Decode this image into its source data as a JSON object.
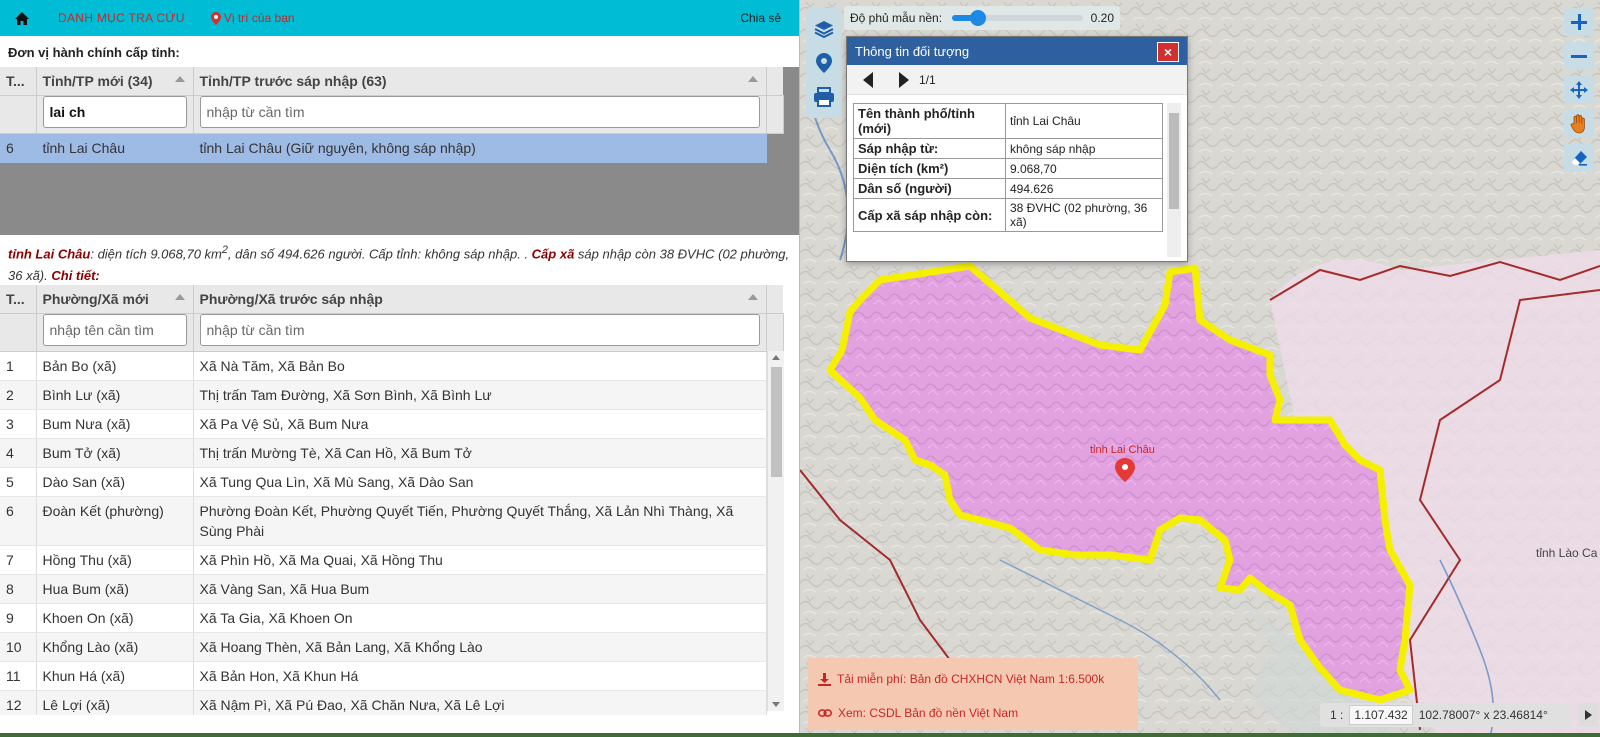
{
  "topbar": {
    "menu": "DANH MỤC TRA CỨU",
    "location": "Vị trí của bạn",
    "share": "Chia sẻ"
  },
  "province_section": {
    "title": "Đơn vị hành chính cấp tỉnh:",
    "columns": [
      "T...",
      "Tỉnh/TP mới (34)",
      "Tỉnh/TP trước sáp nhập (63)"
    ],
    "filter_new_value": "lai ch",
    "filter_old_placeholder": "nhập từ cần tìm",
    "rows": [
      {
        "stt": "6",
        "new": "tỉnh Lai Châu",
        "old": "tỉnh Lai Châu (Giữ nguyên, không sáp nhập)"
      }
    ]
  },
  "summary": {
    "name": "tỉnh Lai Châu",
    "text1": ": diện tích 9.068,70 km",
    "sup": "2",
    "text2": ", dân số 494.626 người. Cấp tỉnh: không sáp nhập. . ",
    "cx_label": "Cấp xã",
    "text3": " sáp nhập còn 38 ĐVHC (02 phường, 36 xã). ",
    "detail": "Chi tiết",
    "colon": ":"
  },
  "ward_section": {
    "columns": [
      "T...",
      "Phường/Xã mới",
      "Phường/Xã trước sáp nhập"
    ],
    "filter_new_placeholder": "nhập tên cần tìm",
    "filter_old_placeholder": "nhập từ cần tìm",
    "rows": [
      {
        "stt": "1",
        "new": "Bản Bo (xã)",
        "old": "Xã Nà Tăm, Xã Bản Bo"
      },
      {
        "stt": "2",
        "new": "Bình Lư (xã)",
        "old": "Thị trấn Tam Đường, Xã Sơn Bình, Xã Bình Lư"
      },
      {
        "stt": "3",
        "new": "Bum Nưa (xã)",
        "old": "Xã Pa Vệ Sủ, Xã Bum Nưa"
      },
      {
        "stt": "4",
        "new": "Bum Tở (xã)",
        "old": "Thị trấn Mường Tè, Xã Can Hồ, Xã Bum Tở"
      },
      {
        "stt": "5",
        "new": "Dào San (xã)",
        "old": "Xã Tung Qua Lìn, Xã Mù Sang, Xã Dào San"
      },
      {
        "stt": "6",
        "new": "Đoàn Kết (phường)",
        "old": "Phường Đoàn Kết, Phường Quyết Tiến, Phường Quyết Thắng, Xã Lản Nhì Thàng, Xã Sùng Phài"
      },
      {
        "stt": "7",
        "new": "Hồng Thu (xã)",
        "old": "Xã Phìn Hồ, Xã Ma Quai, Xã Hồng Thu"
      },
      {
        "stt": "8",
        "new": "Hua Bum (xã)",
        "old": "Xã Vàng San, Xã Hua Bum"
      },
      {
        "stt": "9",
        "new": "Khoen On (xã)",
        "old": "Xã Ta Gia, Xã Khoen On"
      },
      {
        "stt": "10",
        "new": "Khổng Lào (xã)",
        "old": "Xã Hoang Thèn, Xã Bản Lang, Xã Khổng Lào"
      },
      {
        "stt": "11",
        "new": "Khun Há (xã)",
        "old": "Xã Bản Hon, Xã Khun Há"
      },
      {
        "stt": "12",
        "new": "Lê Lợi (xã)",
        "old": "Xã Nậm Pì, Xã Pú Đao, Xã Chăn Nưa, Xã Lê Lợi"
      }
    ]
  },
  "map": {
    "opacity_label": "Độ phủ mẫu nền:",
    "opacity_value": "0.20",
    "opacity_fraction": 0.2,
    "province_label": "tỉnh Lai Châu",
    "neighbor_label": "tỉnh Lào Ca",
    "highlight_color": "#e7a0e6",
    "border_color": "#f5f000",
    "popup": {
      "title": "Thông tin đối tượng",
      "close": "×",
      "counter": "1/1",
      "rows": [
        {
          "k": "Tên thành phố/tỉnh (mới)",
          "v": "tỉnh Lai Châu"
        },
        {
          "k": "Sáp nhập từ:",
          "v": "không sáp nhập"
        },
        {
          "k": "Diện tích (km²)",
          "v": "9.068,70"
        },
        {
          "k": "Dân số (người)",
          "v": "494.626"
        },
        {
          "k": "Cấp xã sáp nhập còn:",
          "v": "38 ĐVHC (02 phường, 36 xã)"
        }
      ]
    },
    "links": {
      "download": "Tải miễn phí: Bản đồ CHXHCN Việt Nam 1:6.500k",
      "view": "Xem: CSDL Bản đồ nền Việt Nam"
    },
    "scale": {
      "prefix": "1 :",
      "value": "1.107.432",
      "coords": "102.78007° x 23.46814°"
    }
  }
}
